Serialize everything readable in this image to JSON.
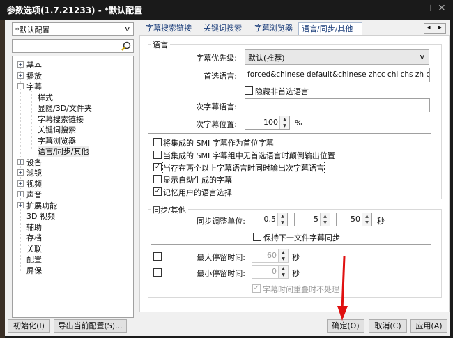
{
  "window": {
    "title": "参数选项(1.7.21233) - *默认配置",
    "pin": "⊣",
    "close": "✕"
  },
  "sidebar": {
    "profile": "*默认配置",
    "profile_arrow": "v",
    "search_placeholder": "",
    "tree": [
      {
        "label": "基本",
        "exp": "+"
      },
      {
        "label": "播放",
        "exp": "+"
      },
      {
        "label": "字幕",
        "exp": "−"
      },
      {
        "label": "样式",
        "child": true
      },
      {
        "label": "显隐/3D/文件夹",
        "child": true
      },
      {
        "label": "字幕搜索链接",
        "child": true
      },
      {
        "label": "关键词搜索",
        "child": true
      },
      {
        "label": "字幕浏览器",
        "child": true
      },
      {
        "label": "语言/同步/其他",
        "child": true,
        "selected": true
      },
      {
        "label": "设备",
        "exp": "+"
      },
      {
        "label": "滤镜",
        "exp": "+"
      },
      {
        "label": "视频",
        "exp": "+"
      },
      {
        "label": "声音",
        "exp": "+"
      },
      {
        "label": "扩展功能",
        "exp": "+"
      },
      {
        "label": "3D 视频"
      },
      {
        "label": "辅助"
      },
      {
        "label": "存档"
      },
      {
        "label": "关联"
      },
      {
        "label": "配置"
      },
      {
        "label": "屏保"
      }
    ]
  },
  "tabs": [
    "字幕搜索链接",
    "关键词搜索",
    "字幕浏览器",
    "语言/同步/其他"
  ],
  "tab_scroll": {
    "left": "◂",
    "right": "▸"
  },
  "language": {
    "title": "语言",
    "priority_label": "字幕优先级:",
    "priority_value": "默认(推荐)",
    "priority_arrow": "v",
    "preferred_label": "首选语言:",
    "preferred_value": "forced&chinese default&chinese zhcc chi chs zh chinese",
    "hide_label": "隐藏非首选语言",
    "hide_checked": false,
    "secondary_label": "次字幕语言:",
    "secondary_value": "",
    "position_label": "次字幕位置:",
    "position_value": "100",
    "position_unit": "%",
    "options": [
      {
        "label": "将集成的 SMI 字幕作为首位字幕",
        "checked": false
      },
      {
        "label": "当集成的 SMI 字幕组中无首选语言时颠倒输出位置",
        "checked": false
      },
      {
        "label": "当存在两个以上字幕语言时同时输出次字幕语言",
        "checked": true
      },
      {
        "label": "显示自动生成的字幕",
        "checked": false
      },
      {
        "label": "记忆用户的语言选择",
        "checked": true
      }
    ]
  },
  "sync": {
    "title": "同步/其他",
    "unit_label": "同步调整单位:",
    "units": [
      "0.5",
      "5",
      "50"
    ],
    "sec": "秒",
    "keep_label": "保持下一文件字幕同步",
    "keep_checked": false,
    "max_label": "最大停留时间:",
    "max_value": "60",
    "max_checked": false,
    "min_label": "最小停留时间:",
    "min_value": "0",
    "min_checked": false,
    "overlap_label": "字幕时间重叠时不处理",
    "overlap_checked": true
  },
  "footer": {
    "init": "初始化(I)",
    "export": "导出当前配置(S)...",
    "ok": "确定(O)",
    "cancel": "取消(C)",
    "apply": "应用(A)"
  },
  "check_mark": "✓",
  "spin_arrows": "▲▼"
}
